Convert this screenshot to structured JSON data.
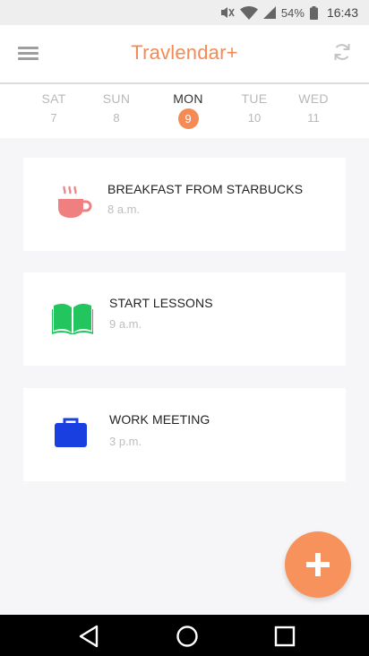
{
  "status_bar": {
    "battery": "54%",
    "time": "16:43",
    "icons": [
      "mute-icon",
      "wifi-icon",
      "signal-icon",
      "battery-icon"
    ]
  },
  "app_bar": {
    "title": "Travlendar+",
    "menu_icon": "hamburger-menu-icon",
    "refresh_icon": "refresh-icon"
  },
  "days": [
    {
      "name": "SAT",
      "num": "7"
    },
    {
      "name": "SUN",
      "num": "8"
    },
    {
      "name": "MON",
      "num": "9",
      "selected": true
    },
    {
      "name": "TUE",
      "num": "10"
    },
    {
      "name": "WED",
      "num": "11"
    }
  ],
  "events": [
    {
      "title": "BREAKFAST FROM STARBUCKS",
      "time": "8 a.m.",
      "icon": "coffee-cup-icon",
      "color": "#f08080"
    },
    {
      "title": "START LESSONS",
      "time": "9 a.m.",
      "icon": "book-icon",
      "color": "#22c55e"
    },
    {
      "title": "WORK MEETING",
      "time": "3 p.m.",
      "icon": "briefcase-icon",
      "color": "#1a3fe0"
    }
  ],
  "fab": {
    "icon": "plus-icon"
  },
  "nav_bar": {
    "icons": [
      "back-icon",
      "home-icon",
      "recents-icon"
    ]
  },
  "colors": {
    "accent": "#f58a55",
    "fab": "#f7925d"
  }
}
